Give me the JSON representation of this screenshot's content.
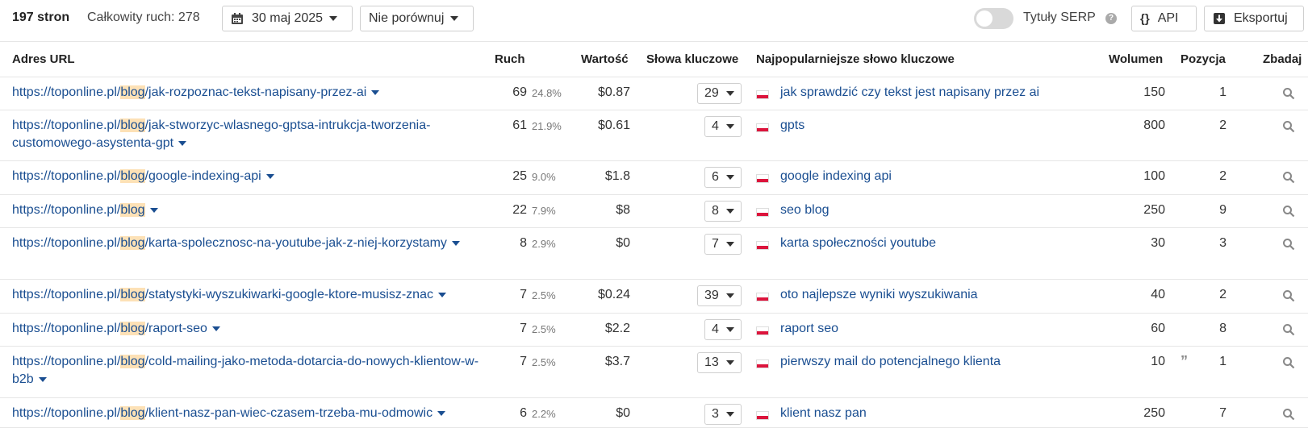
{
  "toolbar": {
    "pages_count": "197 stron",
    "total_traffic": "Całkowity ruch: 278",
    "date_label": "30 maj 2025",
    "compare_label": "Nie porównuj",
    "serp_titles_label": "Tytuły SERP",
    "help_glyph": "?",
    "api_label": "API",
    "api_icon_glyph": "{}",
    "export_label": "Eksportuj"
  },
  "columns": {
    "url": "Adres URL",
    "traffic": "Ruch",
    "value": "Wartość",
    "keywords": "Słowa kluczowe",
    "top_keyword": "Najpopularniejsze słowo kluczowe",
    "volume": "Wolumen",
    "position": "Pozycja",
    "explore": "Zbadaj"
  },
  "rows": [
    {
      "url_prefix": "https://toponline.pl/",
      "url_hl": "blog",
      "url_rest": "/jak-rozpoznac-tekst-napisany-przez-ai",
      "traffic": "69",
      "pct": "24.8%",
      "value": "$0.87",
      "keywords": "29",
      "top_keyword": "jak sprawdzić czy tekst jest napisany przez ai",
      "volume": "150",
      "position": "1"
    },
    {
      "url_prefix": "https://toponline.pl/",
      "url_hl": "blog",
      "url_rest": "/jak-stworzyc-wlasnego-gptsa-intrukcja-tworzenia-customowego-asystenta-gpt",
      "traffic": "61",
      "pct": "21.9%",
      "value": "$0.61",
      "keywords": "4",
      "top_keyword": "gpts",
      "volume": "800",
      "position": "2"
    },
    {
      "url_prefix": "https://toponline.pl/",
      "url_hl": "blog",
      "url_rest": "/google-indexing-api",
      "traffic": "25",
      "pct": "9.0%",
      "value": "$1.8",
      "keywords": "6",
      "top_keyword": "google indexing api",
      "volume": "100",
      "position": "2"
    },
    {
      "url_prefix": "https://toponline.pl/",
      "url_hl": "blog",
      "url_rest": "",
      "traffic": "22",
      "pct": "7.9%",
      "value": "$8",
      "keywords": "8",
      "top_keyword": "seo blog",
      "volume": "250",
      "position": "9"
    },
    {
      "url_prefix": "https://toponline.pl/",
      "url_hl": "blog",
      "url_rest": "/karta-spolecznosc-na-youtube-jak-z-niej-korzystamy",
      "traffic": "8",
      "pct": "2.9%",
      "value": "$0",
      "keywords": "7",
      "top_keyword": "karta społeczności youtube",
      "volume": "30",
      "position": "3"
    },
    {
      "url_prefix": "https://toponline.pl/",
      "url_hl": "blog",
      "url_rest": "/statystyki-wyszukiwarki-google-ktore-musisz-znac",
      "traffic": "7",
      "pct": "2.5%",
      "value": "$0.24",
      "keywords": "39",
      "top_keyword": "oto najlepsze wyniki wyszukiwania",
      "volume": "40",
      "position": "2"
    },
    {
      "url_prefix": "https://toponline.pl/",
      "url_hl": "blog",
      "url_rest": "/raport-seo",
      "traffic": "7",
      "pct": "2.5%",
      "value": "$2.2",
      "keywords": "4",
      "top_keyword": "raport seo",
      "volume": "60",
      "position": "8"
    },
    {
      "url_prefix": "https://toponline.pl/",
      "url_hl": "blog",
      "url_rest": "/cold-mailing-jako-metoda-dotarcia-do-nowych-klientow-w-b2b",
      "traffic": "7",
      "pct": "2.5%",
      "value": "$3.7",
      "keywords": "13",
      "top_keyword": "pierwszy mail do potencjalnego klienta",
      "volume": "10",
      "position": "1"
    },
    {
      "url_prefix": "https://toponline.pl/",
      "url_hl": "blog",
      "url_rest": "/klient-nasz-pan-wiec-czasem-trzeba-mu-odmowic",
      "traffic": "6",
      "pct": "2.2%",
      "value": "$0",
      "keywords": "3",
      "top_keyword": "klient nasz pan",
      "volume": "250",
      "position": "7"
    }
  ],
  "icons": {
    "calendar": "calendar-icon",
    "export": "download-icon",
    "flag": "poland-flag-icon",
    "search": "search-icon",
    "quote": "quote-icon"
  },
  "colors": {
    "link": "#1a4e91",
    "highlight": "#fde1b6",
    "flag_red": "#dc143c"
  }
}
